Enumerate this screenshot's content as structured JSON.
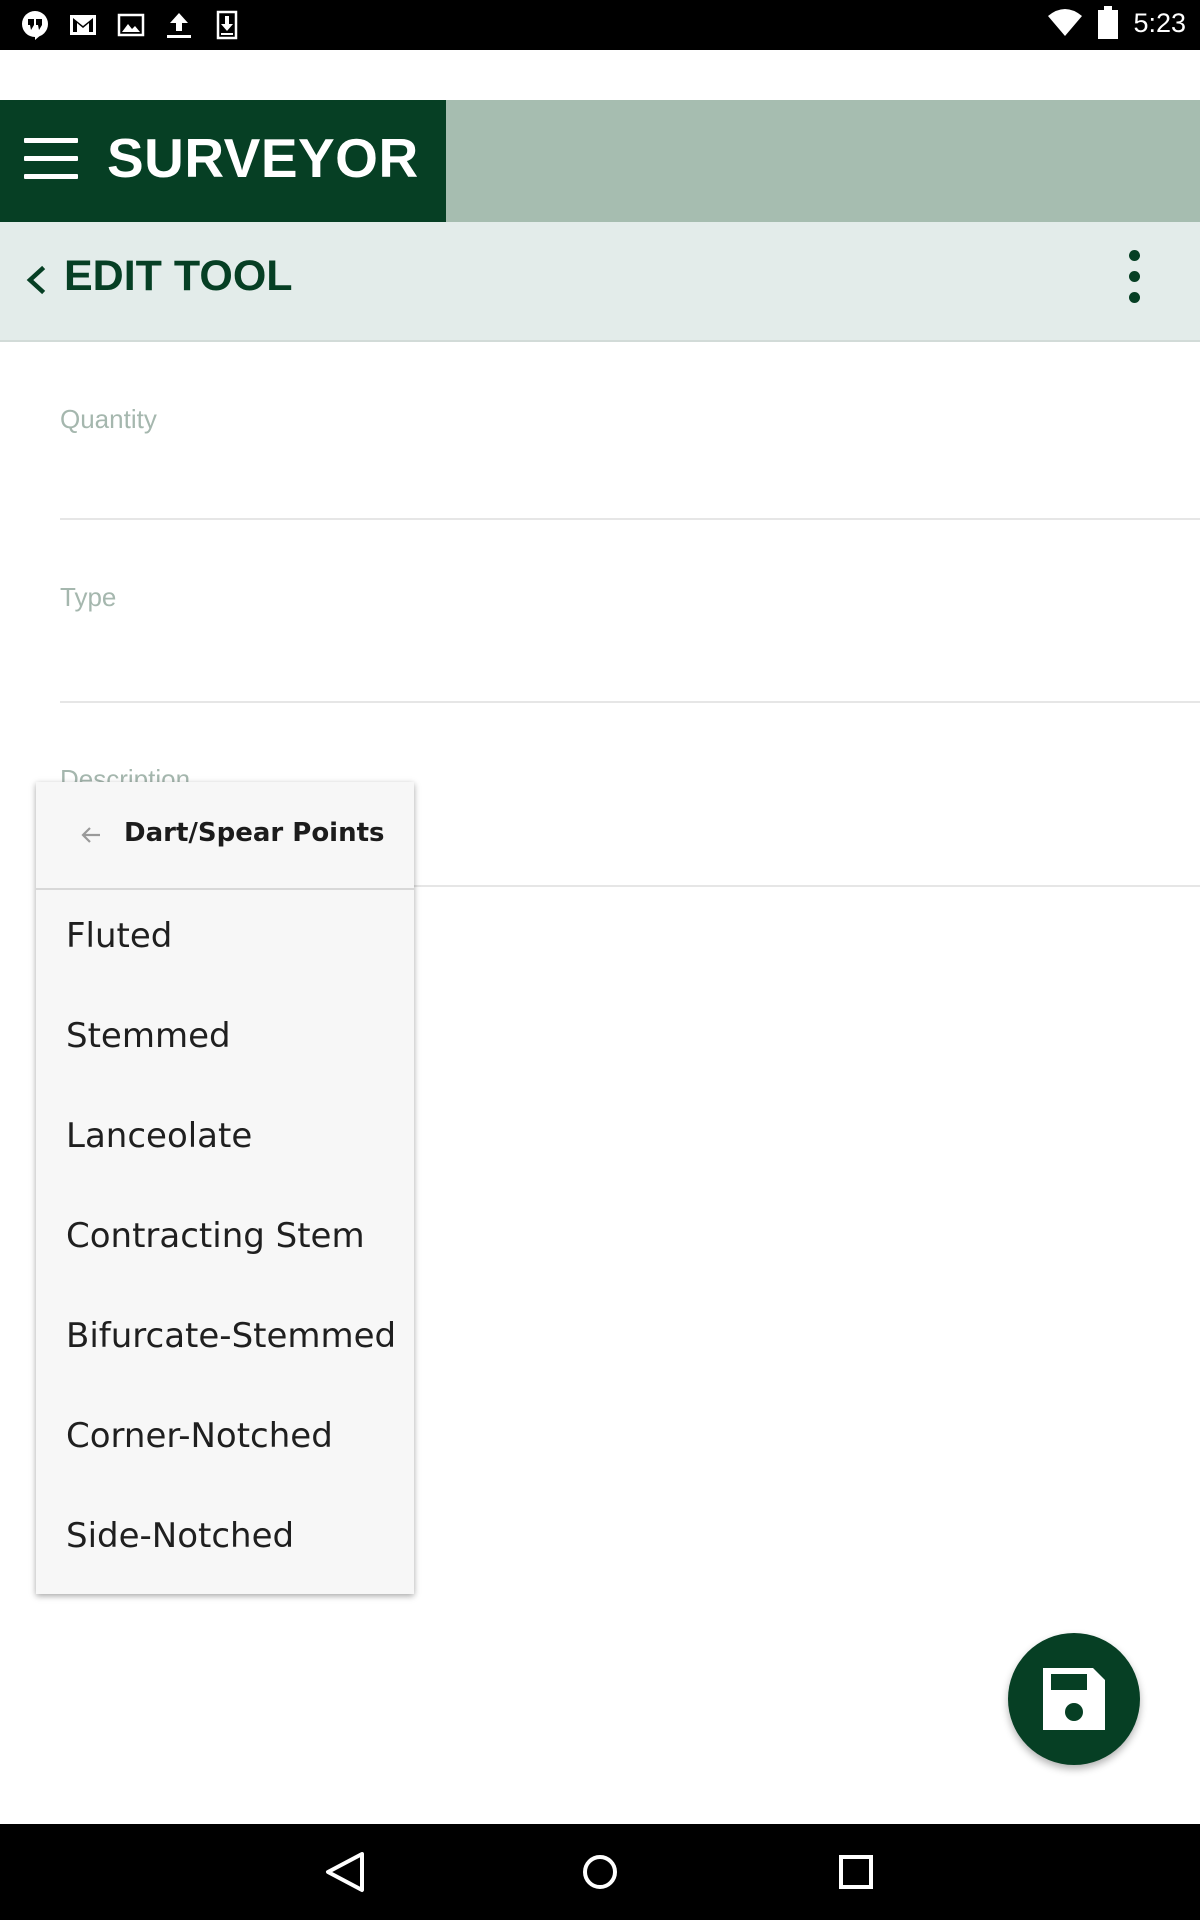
{
  "status_bar": {
    "time": "5:23",
    "notification_icons": [
      "hangouts-icon",
      "gmail-icon",
      "image-icon",
      "upload-icon",
      "download-icon"
    ],
    "system_icons": [
      "wifi-icon",
      "battery-icon"
    ]
  },
  "app_bar": {
    "title": "SURVEYOR",
    "menu_icon": "hamburger-menu-icon",
    "colors": {
      "brand": "#063f24",
      "bar": "#a6bdb0"
    }
  },
  "sub_header": {
    "title": "EDIT TOOL",
    "back_icon": "chevron-left-icon",
    "overflow_icon": "more-vert-icon"
  },
  "form": {
    "quantity_label": "Quantity",
    "type_label": "Type",
    "description_label": "Description"
  },
  "dropdown": {
    "title": "Dart/Spear Points",
    "back_icon": "arrow-left-icon",
    "items": [
      "Fluted",
      "Stemmed",
      "Lanceolate",
      "Contracting Stem",
      "Bifurcate-Stemmed",
      "Corner-Notched",
      "Side-Notched"
    ]
  },
  "fab": {
    "icon": "save-icon",
    "color": "#063f24"
  },
  "nav_bar": {
    "icons": [
      "nav-back-icon",
      "nav-home-icon",
      "nav-recents-icon"
    ]
  }
}
